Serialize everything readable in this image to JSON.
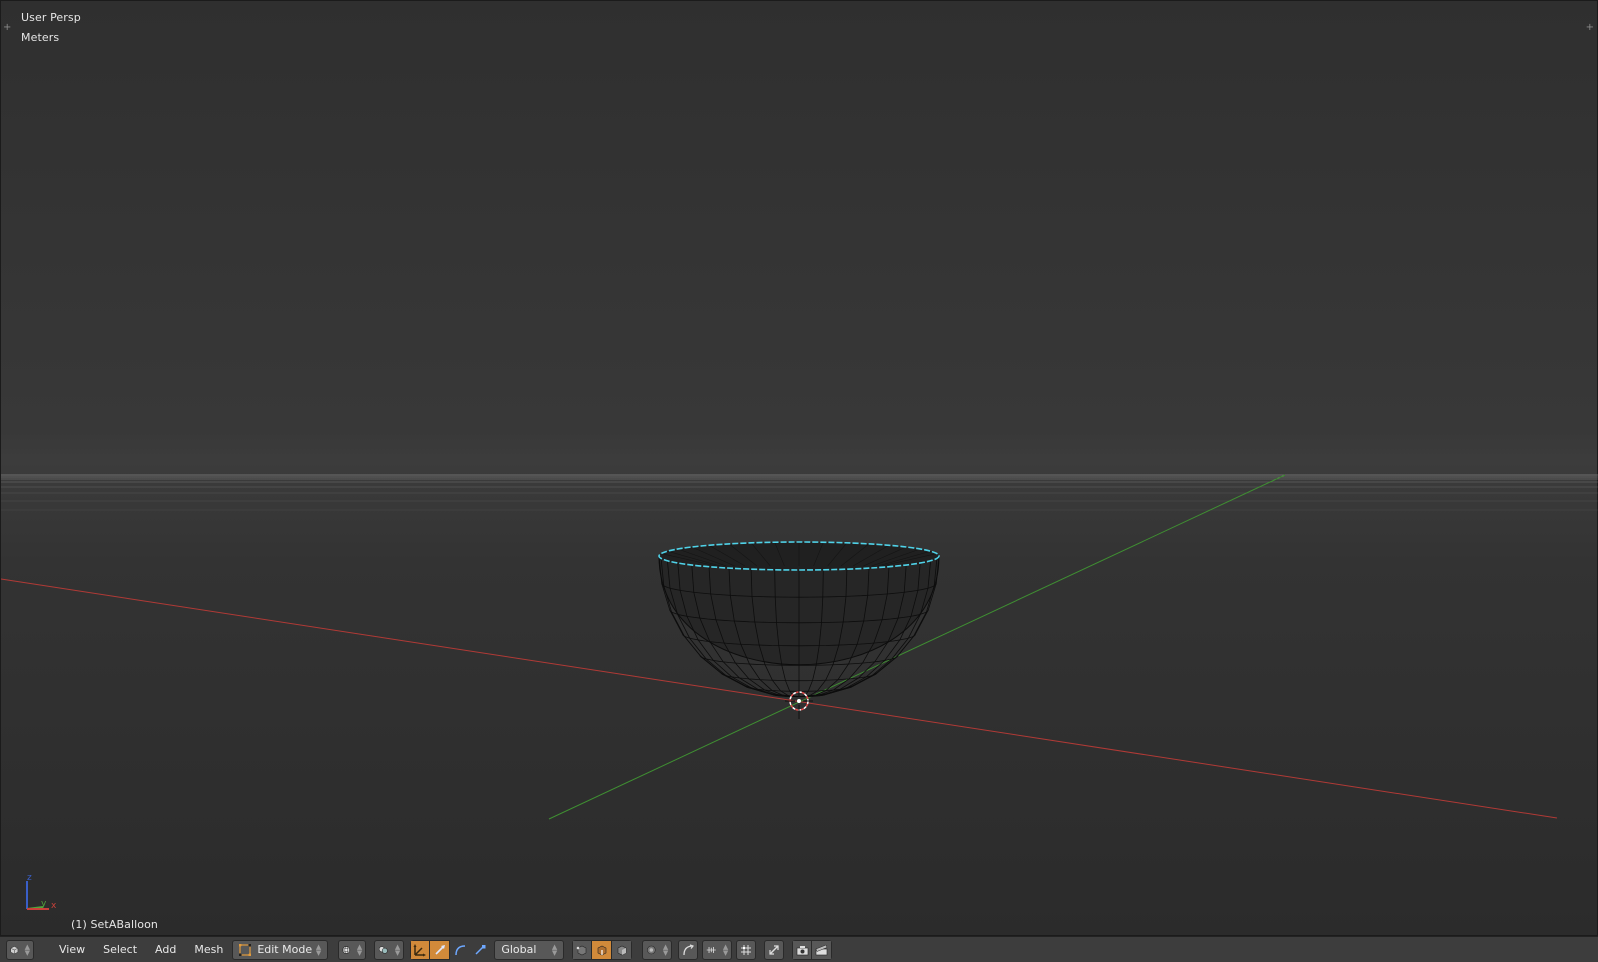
{
  "viewport": {
    "view_name": "User Persp",
    "units": "Meters",
    "object_info": "(1) SetABalloon"
  },
  "axes_widget": {
    "labels": [
      "z",
      "y",
      "x"
    ],
    "colors": {
      "x": "#c8413a",
      "y": "#4fa33b",
      "z": "#3a5fc8"
    }
  },
  "colors": {
    "x_axis_line": "#b13a36",
    "y_axis_line": "#3f8f32",
    "mesh_wire": "#0d0d0d",
    "selected_edge": "#4fd2e8",
    "cursor": "#e24a4a",
    "active_toggle": "#d18a3a"
  },
  "header": {
    "menus": [
      "View",
      "Select",
      "Add",
      "Mesh"
    ],
    "mode": "Edit Mode",
    "orientation": "Global",
    "editor_type_icon": "cube-icon",
    "viewport_shading_icon": "sphere-shading-icon",
    "pivot_icon": "pivot-point-icon",
    "manipulator_icons": [
      "translate-manipulator-icon",
      "rotate-manipulator-icon",
      "scale-manipulator-icon"
    ],
    "select_mode_icons": [
      "vertex-select-icon",
      "edge-select-icon",
      "face-select-icon"
    ],
    "snap_icons": [
      "proportional-edit-icon",
      "proportional-falloff-icon",
      "snap-toggle-icon",
      "snap-element-icon"
    ],
    "render_icons": [
      "mesh-tools-icon",
      "camera-render-icon",
      "clapper-render-icon"
    ]
  }
}
